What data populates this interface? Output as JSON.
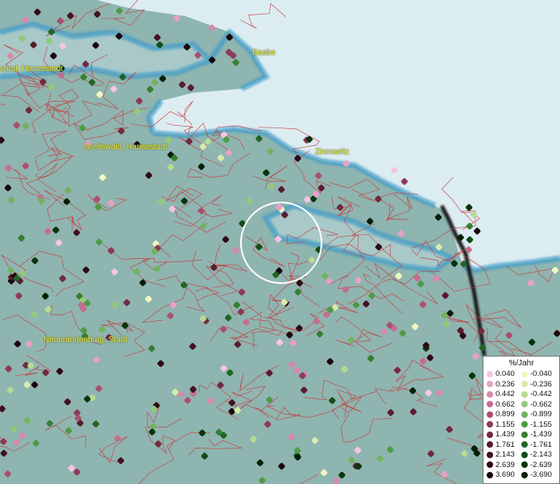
{
  "map": {
    "places": [
      {
        "name": "Baabe"
      },
      {
        "name": "sund, Hansestadt"
      },
      {
        "name": "Greifswald, Hansestadt"
      },
      {
        "name": "Zinnowitz"
      },
      {
        "name": "Neubrandenburg, Stadt"
      }
    ],
    "colors": {
      "sea": "#dcedf2",
      "coast": "#3f9bc7",
      "land": "#8fb5b0",
      "borders": "#c8383a",
      "national_border": "#1a1a1a",
      "place_label": "#f2e63a"
    },
    "highlight_marker": "selection-circle"
  },
  "legend": {
    "title": "%/Jahr",
    "positive": [
      {
        "value": "0.040",
        "color": "#f7c4e4"
      },
      {
        "value": "0.236",
        "color": "#e9a0c6"
      },
      {
        "value": "0.442",
        "color": "#d988ad"
      },
      {
        "value": "0.662",
        "color": "#c56d8f"
      },
      {
        "value": "0.899",
        "color": "#a9506f"
      },
      {
        "value": "1.155",
        "color": "#8d3a55"
      },
      {
        "value": "1.439",
        "color": "#722a41"
      },
      {
        "value": "1.761",
        "color": "#5a1c30"
      },
      {
        "value": "2.143",
        "color": "#431221"
      },
      {
        "value": "2.639",
        "color": "#2e0a15"
      },
      {
        "value": "3.690",
        "color": "#1a040a"
      }
    ],
    "negative": [
      {
        "value": "-0.040",
        "color": "#f2f7c0"
      },
      {
        "value": "-0.236",
        "color": "#d6ecac"
      },
      {
        "value": "-0.442",
        "color": "#b6dc94"
      },
      {
        "value": "-0.662",
        "color": "#93c97a"
      },
      {
        "value": "-0.899",
        "color": "#71b35f"
      },
      {
        "value": "-1.155",
        "color": "#4f9a46"
      },
      {
        "value": "-1.439",
        "color": "#357f33"
      },
      {
        "value": "-1.761",
        "color": "#206524"
      },
      {
        "value": "-2.143",
        "color": "#124c17"
      },
      {
        "value": "-2.639",
        "color": "#08340d"
      },
      {
        "value": "-3.690",
        "color": "#031f06"
      }
    ]
  }
}
